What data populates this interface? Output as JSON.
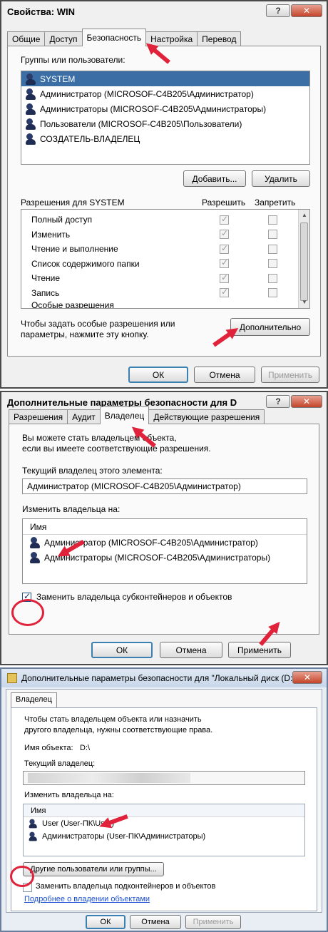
{
  "dialog1": {
    "title": "Свойства: WIN",
    "tabs": [
      "Общие",
      "Доступ",
      "Безопасность",
      "Настройка",
      "Перевод"
    ],
    "groups_label": "Группы или пользователи:",
    "users": [
      "SYSTEM",
      "Администратор (MICROSOF-C4B205\\Администратор)",
      "Администраторы (MICROSOF-C4B205\\Администраторы)",
      "Пользователи (MICROSOF-C4B205\\Пользователи)",
      "СОЗДАТЕЛЬ-ВЛАДЕЛЕЦ"
    ],
    "add_button": "Добавить...",
    "remove_button": "Удалить",
    "permissions_for": "Разрешения для SYSTEM",
    "allow_header": "Разрешить",
    "deny_header": "Запретить",
    "permissions": [
      "Полный доступ",
      "Изменить",
      "Чтение и выполнение",
      "Список содержимого папки",
      "Чтение",
      "Запись",
      "Особые разрешения"
    ],
    "advanced_hint_line1": "Чтобы задать особые разрешения или",
    "advanced_hint_line2": "параметры, нажмите эту кнопку.",
    "advanced_button": "Дополнительно",
    "ok": "ОК",
    "cancel": "Отмена",
    "apply": "Применить"
  },
  "dialog2": {
    "title": "Дополнительные параметры безопасности для D",
    "tabs": [
      "Разрешения",
      "Аудит",
      "Владелец",
      "Действующие разрешения"
    ],
    "info_line1": "Вы можете стать владельцем объекта,",
    "info_line2": "если вы имеете соответствующие разрешения.",
    "current_owner_label": "Текущий владелец этого элемента:",
    "current_owner_value": "Администратор (MICROSOF-C4B205\\Администратор)",
    "change_owner_label": "Изменить владельца на:",
    "name_header": "Имя",
    "owners": [
      "Администратор (MICROSOF-C4B205\\Администратор)",
      "Администраторы (MICROSOF-C4B205\\Администраторы)"
    ],
    "replace_owner_checkbox": "Заменить владельца субконтейнеров и объектов",
    "ok": "ОК",
    "cancel": "Отмена",
    "apply": "Применить"
  },
  "dialog3": {
    "title": "Дополнительные параметры безопасности  для \"Локальный диск (D:)\"",
    "tab": "Владелец",
    "info_line1": "Чтобы стать владельцем объекта или назначить",
    "info_line2": "другого владельца, нужны соответствующие права.",
    "object_name_label": "Имя объекта:",
    "object_name_value": "D:\\",
    "current_owner_label": "Текущий владелец:",
    "change_owner_label": "Изменить владельца на:",
    "name_header": "Имя",
    "owners": [
      "User (User-ПК\\User)",
      "Администраторы (User-ПК\\Администраторы)"
    ],
    "other_users_button": "Другие пользователи или группы...",
    "replace_owner_checkbox": "Заменить владельца подконтейнеров и объектов",
    "more_link": "Подробнее о владении объектами",
    "ok": "ОК",
    "cancel": "Отмена",
    "apply": "Применить"
  },
  "colors": {
    "selection": "#3a6ea5",
    "annotation_red": "#e0223a",
    "link": "#1a4fd1"
  }
}
